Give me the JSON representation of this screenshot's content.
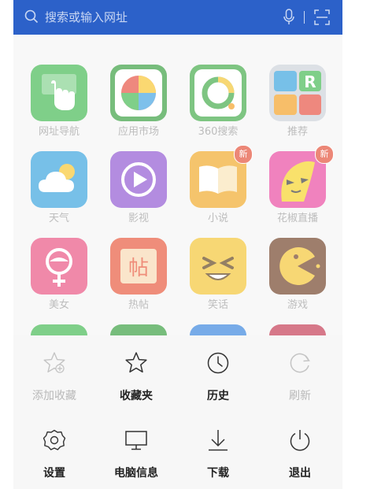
{
  "search": {
    "placeholder": "搜索或输入网址"
  },
  "apps": [
    {
      "label": "网址导航",
      "icon": "nav-hand-icon",
      "color": "#3bb54a"
    },
    {
      "label": "应用市场",
      "icon": "app-market-icon",
      "color": "#2f9a36"
    },
    {
      "label": "360搜索",
      "icon": "search360-icon",
      "color": "#3aa640"
    },
    {
      "label": "推荐",
      "icon": "recommend-icon",
      "color": "#9aa3b0"
    },
    {
      "label": "天气",
      "icon": "weather-icon",
      "color": "#2e9fdc"
    },
    {
      "label": "影视",
      "icon": "video-play-icon",
      "color": "#8a4fcf"
    },
    {
      "label": "小说",
      "icon": "book-icon",
      "color": "#f0a51e",
      "badge": "新"
    },
    {
      "label": "花椒直播",
      "icon": "huajiao-icon",
      "color": "#e83f9b",
      "badge": "新"
    },
    {
      "label": "美女",
      "icon": "female-icon",
      "color": "#e84a7b"
    },
    {
      "label": "热帖",
      "icon": "hot-post-icon",
      "color": "#e65133"
    },
    {
      "label": "笑话",
      "icon": "joke-face-icon",
      "color": "#f3c22a"
    },
    {
      "label": "游戏",
      "icon": "pacman-icon",
      "color": "#6b3a1e"
    }
  ],
  "menu": [
    {
      "label": "添加收藏",
      "icon": "add-favorite-icon",
      "disabled": true
    },
    {
      "label": "收藏夹",
      "icon": "favorites-star-icon",
      "disabled": false
    },
    {
      "label": "历史",
      "icon": "history-clock-icon",
      "disabled": false
    },
    {
      "label": "刷新",
      "icon": "refresh-icon",
      "disabled": true
    },
    {
      "label": "设置",
      "icon": "settings-gear-icon",
      "disabled": false
    },
    {
      "label": "电脑信息",
      "icon": "computer-monitor-icon",
      "disabled": false
    },
    {
      "label": "下载",
      "icon": "download-icon",
      "disabled": false
    },
    {
      "label": "退出",
      "icon": "power-icon",
      "disabled": false
    }
  ]
}
